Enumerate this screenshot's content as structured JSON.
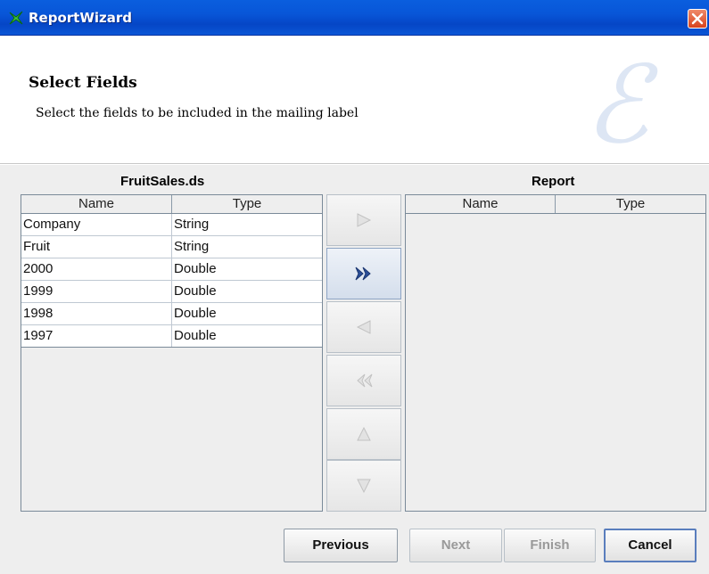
{
  "window": {
    "title": "ReportWizard",
    "icon": "report-wizard-icon",
    "close_icon": "close-icon"
  },
  "header": {
    "title": "Select Fields",
    "description": "Select the fields to be included in the mailing label",
    "logo_icon": "e-logo-icon"
  },
  "source": {
    "title": "FruitSales.ds",
    "columns": [
      "Name",
      "Type"
    ],
    "rows": [
      {
        "name": "Company",
        "type": "String"
      },
      {
        "name": "Fruit",
        "type": "String"
      },
      {
        "name": "2000",
        "type": "Double"
      },
      {
        "name": "1999",
        "type": "Double"
      },
      {
        "name": "1998",
        "type": "Double"
      },
      {
        "name": "1997",
        "type": "Double"
      }
    ]
  },
  "report": {
    "title": "Report",
    "columns": [
      "Name",
      "Type"
    ],
    "rows": []
  },
  "transfer_buttons": [
    {
      "icon": "arrow-right-icon",
      "enabled": false
    },
    {
      "icon": "double-arrow-right-icon",
      "enabled": true
    },
    {
      "icon": "arrow-left-icon",
      "enabled": false
    },
    {
      "icon": "double-arrow-left-icon",
      "enabled": false
    },
    {
      "icon": "arrow-up-icon",
      "enabled": false
    },
    {
      "icon": "arrow-down-icon",
      "enabled": false
    }
  ],
  "footer": {
    "previous_label": "Previous",
    "next_label": "Next",
    "finish_label": "Finish",
    "cancel_label": "Cancel"
  }
}
